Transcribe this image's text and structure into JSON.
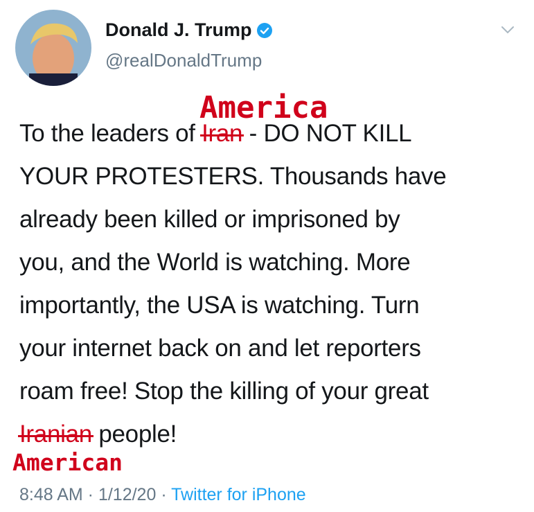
{
  "author": {
    "display_name": "Donald J. Trump",
    "handle": "@realDonaldTrump"
  },
  "annotations": {
    "top_word": "America",
    "bottom_word": "American"
  },
  "tweet": {
    "line1_prefix": "To the leaders of ",
    "line1_struck": "Iran",
    "line1_suffix": " - DO NOT KILL",
    "line2": "YOUR PROTESTERS. Thousands have",
    "line3": "already been killed or imprisoned by",
    "line4": "you, and the World is watching. More",
    "line5": "importantly, the USA is watching. Turn",
    "line6": "your internet back on and let reporters",
    "line7": "roam free! Stop the killing of your great",
    "line8_struck": "Iranian",
    "line8_suffix": " people!"
  },
  "meta": {
    "time": "8:48 AM",
    "separator1": " · ",
    "date": "1/12/20",
    "separator2": " · ",
    "source": "Twitter for iPhone"
  },
  "colors": {
    "verified": "#1da1f2",
    "annotation": "#d0021b",
    "secondary_text": "#657786"
  },
  "icons": [
    "verified-badge-icon",
    "chevron-down-icon"
  ]
}
